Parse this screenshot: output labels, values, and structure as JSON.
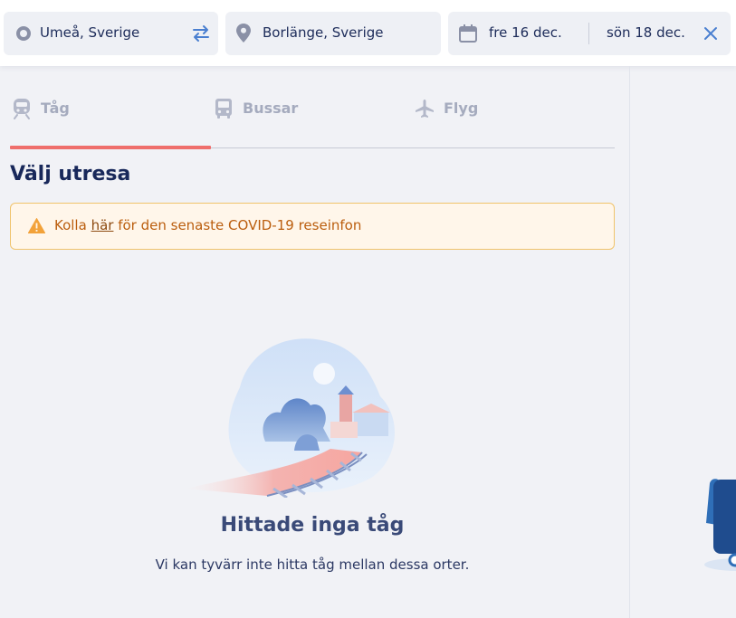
{
  "search": {
    "from": "Umeå, Sverige",
    "to": "Borlänge, Sverige",
    "outbound_date": "fre 16 dec.",
    "return_date": "sön 18 dec."
  },
  "tabs": [
    {
      "label": "Tåg",
      "icon": "train-icon",
      "active": true
    },
    {
      "label": "Bussar",
      "icon": "bus-icon",
      "active": false
    },
    {
      "label": "Flyg",
      "icon": "plane-icon",
      "active": false
    }
  ],
  "main": {
    "title": "Välj utresa",
    "alert": {
      "prefix": "Kolla ",
      "link": "här",
      "suffix": " för den senaste COVID-19 reseinfon"
    },
    "empty_state": {
      "title": "Hittade inga tåg",
      "text": "Vi kan tyvärr inte hitta tåg mellan dessa orter."
    }
  },
  "colors": {
    "accent": "#ef6f6c",
    "primary_text": "#18285a",
    "alert_text": "#bb5e0e",
    "alert_border": "#f0c36b",
    "inactive_tab": "#a5abbe"
  }
}
